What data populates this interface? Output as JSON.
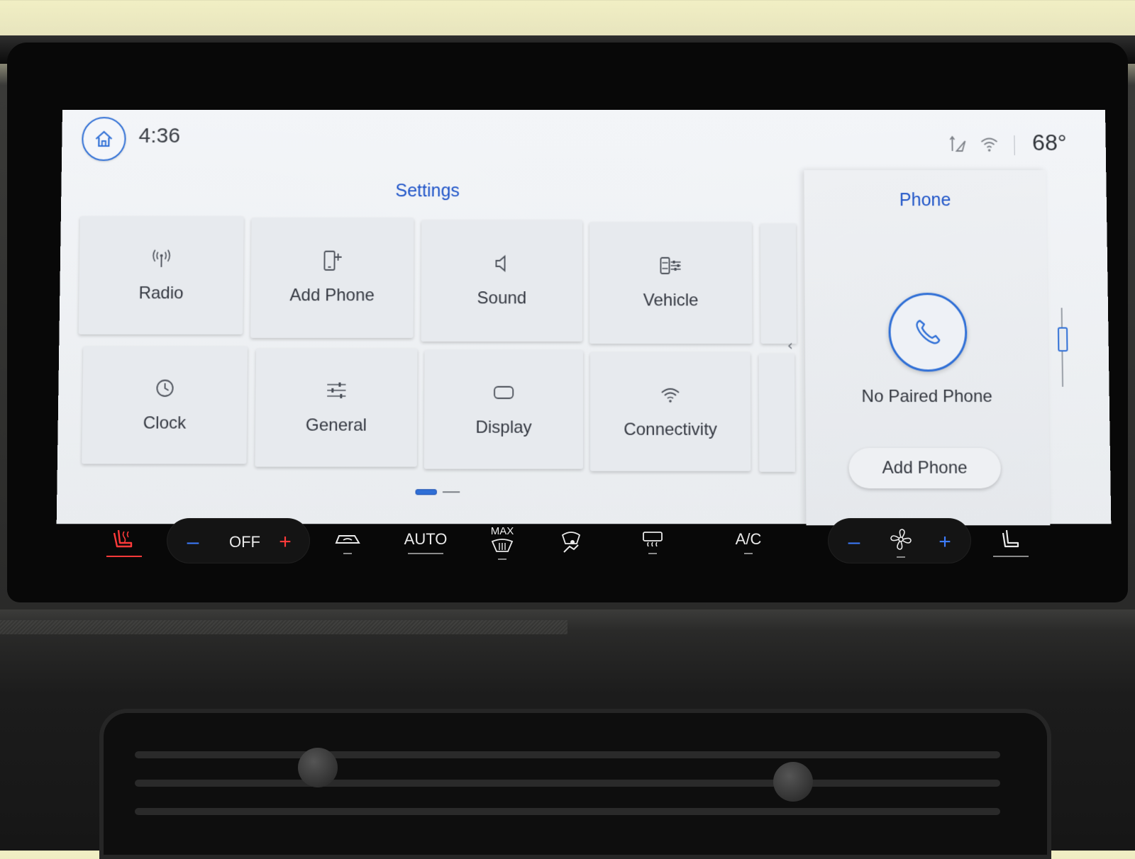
{
  "header": {
    "time": "4:36",
    "temperature": "68°"
  },
  "settings": {
    "title": "Settings",
    "tiles": [
      {
        "label": "Radio",
        "icon": "radio-antenna-icon"
      },
      {
        "label": "Add Phone",
        "icon": "add-phone-icon"
      },
      {
        "label": "Sound",
        "icon": "speaker-icon"
      },
      {
        "label": "Vehicle",
        "icon": "vehicle-settings-icon"
      },
      {
        "label": "Clock",
        "icon": "clock-icon"
      },
      {
        "label": "General",
        "icon": "sliders-icon"
      },
      {
        "label": "Display",
        "icon": "display-icon"
      },
      {
        "label": "Connectivity",
        "icon": "wifi-icon"
      }
    ],
    "page_count": 2,
    "active_page": 1
  },
  "phone": {
    "title": "Phone",
    "status": "No Paired Phone",
    "add_button": "Add Phone"
  },
  "climate": {
    "temp_minus": "–",
    "temp_value": "OFF",
    "temp_plus": "+",
    "auto": "AUTO",
    "max": "MAX",
    "ac": "A/C",
    "fan_minus": "–",
    "fan_plus": "+"
  },
  "colors": {
    "accent": "#2f6fd6",
    "title_blue": "#2055c8",
    "climate_blue": "#3d7cff",
    "climate_red": "#ff3a3a"
  }
}
